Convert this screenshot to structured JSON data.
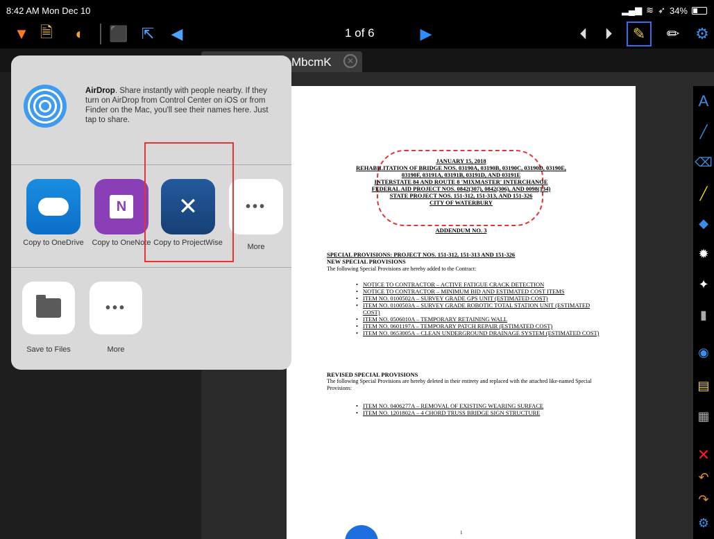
{
  "status_bar": {
    "time": "8:42 AM  Mon Dec 10",
    "battery": "34%"
  },
  "toolbar": {
    "page_indicator": "1 of 6"
  },
  "tab": {
    "label": "MbcmK",
    "close_glyph": "✕"
  },
  "share_sheet": {
    "airdrop_title": "AirDrop",
    "airdrop_text": ". Share instantly with people nearby. If they turn on AirDrop from Control Center on iOS or from Finder on the Mac, you'll see their names here. Just tap to share.",
    "apps": [
      {
        "label": "Copy to OneDrive"
      },
      {
        "label": "Copy to OneNote"
      },
      {
        "label": "Copy to ProjectWise"
      },
      {
        "label": "More"
      }
    ],
    "actions": [
      {
        "label": "Save to Files"
      },
      {
        "label": "More"
      }
    ]
  },
  "document": {
    "header_lines": [
      "JANUARY 15, 2018",
      "REHABILITATION OF BRIDGE NOS. 03190A, 03190B, 03190C, 03190D, 03190E,",
      "03190F, 03191A, 03191B, 03191D, AND 03191E",
      "INTERSTATE 84 AND ROUTE 8 'MIXMASTER' INTERCHANGE",
      "FEDERAL AID PROJECT NOS. 0842(307), 0842(306), AND 0098(134)",
      "STATE PROJECT NOS. 151-312, 151-313, AND 151-326",
      "CITY OF WATERBURY"
    ],
    "addendum": "ADDENDUM NO. 3",
    "special_provisions": "SPECIAL PROVISIONS: PROJECT NOS. 151-312, 151-313 AND 151-326",
    "new_special_provisions": "NEW SPECIAL PROVISIONS",
    "new_intro": "The following Special Provisions are hereby added to the Contract:",
    "new_items": [
      "NOTICE TO CONTRACTOR – ACTIVE FATIGUE CRACK DETECTION",
      "NOTICE TO CONTRACTOR – MINIMUM BID AND ESTIMATED COST ITEMS",
      "ITEM NO. 0100502A – SURVEY GRADE GPS UNIT (ESTIMATED COST)",
      "ITEM NO. 0100503A – SURVEY GRADE ROBOTIC TOTAL STATION UNIT (ESTIMATED COST)",
      "ITEM NO. 0506010A – TEMPORARY RETAINING WALL",
      "ITEM NO. 0601197A – TEMPORARY PATCH REPAIR (ESTIMATED COST)",
      "ITEM NO. 0653005A – CLEAN UNDERGROUND DRAINAGE SYSTEM (ESTIMATED COST)"
    ],
    "revised_special_provisions": "REVISED SPECIAL PROVISIONS",
    "revised_intro": "The following Special Provisions are hereby deleted in their entirety and replaced with the attached like-named Special Provisions:",
    "revised_items": [
      "ITEM NO. 0406277A – REMOVAL OF EXISTING WEARING SURFACE",
      "ITEM NO. 1201802A – 4 CHORD TRUSS BRIDGE SIGN STRUCTURE"
    ],
    "page_number": "1"
  },
  "colors": {
    "accent": "#2f6ff0",
    "highlight": "#e03535",
    "toolbar_bg": "#000000"
  }
}
